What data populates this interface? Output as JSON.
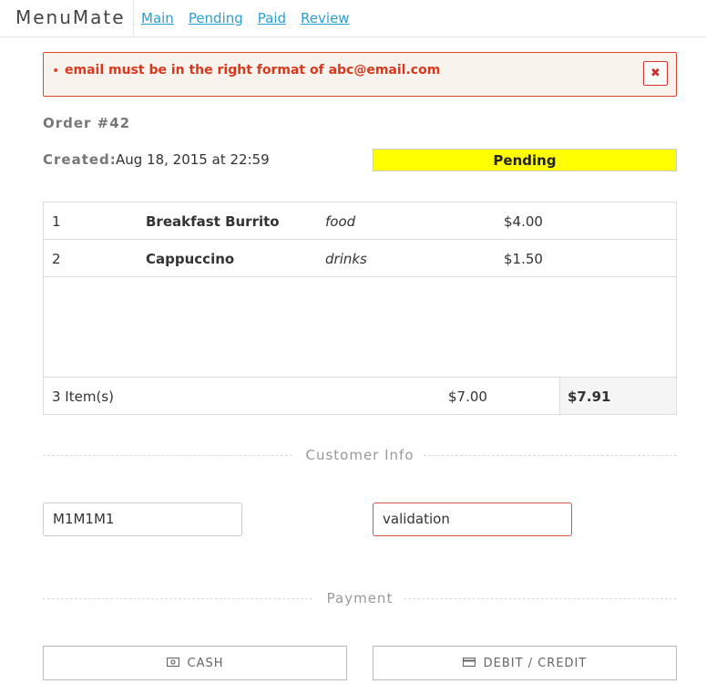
{
  "nav": {
    "brand": "MenuMate",
    "links": [
      "Main",
      "Pending",
      "Paid",
      "Review"
    ]
  },
  "alert": {
    "message": "email must be in the right format of abc@email.com",
    "close_icon": "✖"
  },
  "order": {
    "title": "Order #42",
    "created_label": "Created:",
    "created_value": "Aug 18, 2015 at 22:59",
    "status": "Pending"
  },
  "items": [
    {
      "num": "1",
      "name": "Breakfast Burrito",
      "category": "food",
      "price": "$4.00"
    },
    {
      "num": "2",
      "name": "Cappuccino",
      "category": "drinks",
      "price": "$1.50"
    }
  ],
  "totals": {
    "count": "3 Item(s)",
    "subtotal": "$7.00",
    "grand_total": "$7.91"
  },
  "customer": {
    "section_label": "Customer Info",
    "postal_value": "M1M1M1",
    "email_value": "validation"
  },
  "payment": {
    "section_label": "Payment",
    "cash_label": "CASH",
    "card_label": "DEBIT / CREDIT",
    "cash_icon": "money-icon",
    "card_icon": "credit-card-icon"
  },
  "colors": {
    "link": "#2a9fd6",
    "alert_border": "#e0462f",
    "status_bg": "#ffff00"
  }
}
